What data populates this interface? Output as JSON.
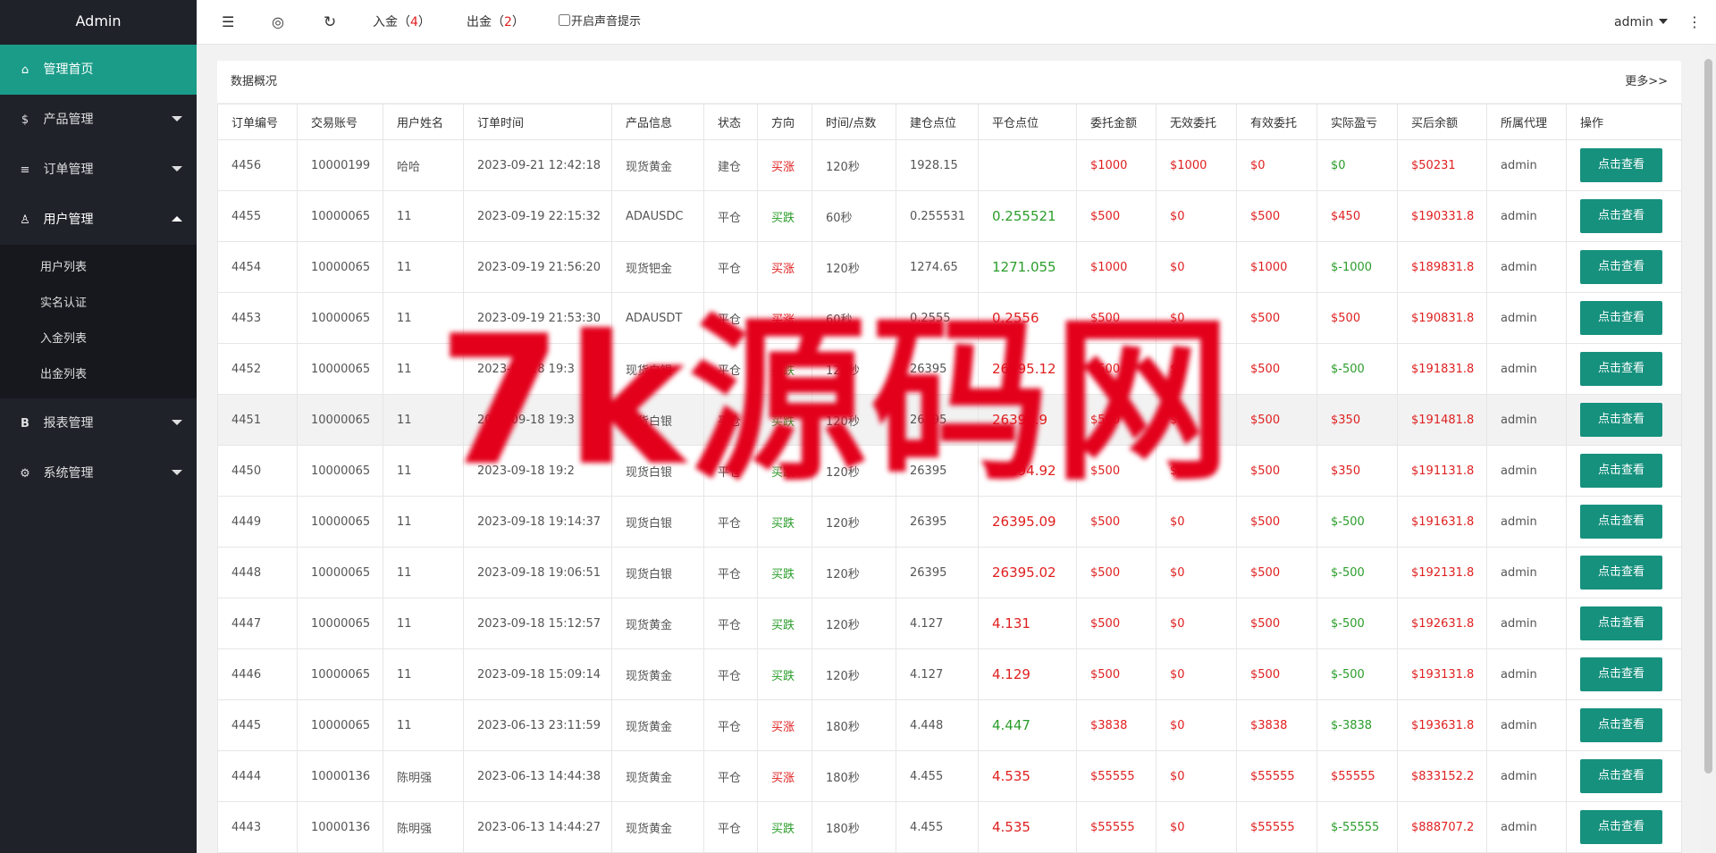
{
  "app": {
    "title": "Admin"
  },
  "sidebar": {
    "items": [
      {
        "label": "管理首页",
        "icon": "home-icon",
        "glyph": "⌂"
      },
      {
        "label": "产品管理",
        "icon": "dollar-circle-icon",
        "glyph": "$"
      },
      {
        "label": "订单管理",
        "icon": "layers-icon",
        "glyph": "≡"
      },
      {
        "label": "用户管理",
        "icon": "user-icon",
        "glyph": "♙"
      },
      {
        "label": "报表管理",
        "icon": "bold-b-icon",
        "glyph": "B"
      },
      {
        "label": "系统管理",
        "icon": "gear-icon",
        "glyph": "⚙"
      }
    ],
    "user_submenu": [
      {
        "label": "用户列表"
      },
      {
        "label": "实名认证"
      },
      {
        "label": "入金列表"
      },
      {
        "label": "出金列表"
      }
    ]
  },
  "header": {
    "menu_toggle_glyph": "☰",
    "globe_glyph": "◎",
    "refresh_glyph": "↻",
    "deposit": {
      "label": "入金（",
      "count": "4",
      "close": "）"
    },
    "withdraw": {
      "label": "出金（",
      "count": "2",
      "close": "）"
    },
    "sound_label": "开启声音提示",
    "user": "admin",
    "more_glyph": "⋮"
  },
  "card": {
    "title": "数据概况",
    "more": "更多>>"
  },
  "table": {
    "headers": [
      "订单编号",
      "交易账号",
      "用户姓名",
      "订单时间",
      "产品信息",
      "状态",
      "方向",
      "时间/点数",
      "建仓点位",
      "平仓点位",
      "委托金额",
      "无效委托",
      "有效委托",
      "实际盈亏",
      "买后余额",
      "所属代理",
      "操作"
    ],
    "button_label": "点击查看",
    "rows": [
      [
        "4456",
        "10000199",
        "哈哈",
        "2023-09-21 12:42:18",
        "现货黄金",
        "建仓",
        "买涨",
        "120秒",
        "1928.15",
        "",
        "$1000",
        "$1000",
        "$0",
        "$0",
        "$50231",
        "admin"
      ],
      [
        "4455",
        "10000065",
        "11",
        "2023-09-19 22:15:32",
        "ADAUSDC",
        "平仓",
        "买跌",
        "60秒",
        "0.255531",
        "0.255521",
        "$500",
        "$0",
        "$500",
        "$450",
        "$190331.8",
        "admin"
      ],
      [
        "4454",
        "10000065",
        "11",
        "2023-09-19 21:56:20",
        "现货钯金",
        "平仓",
        "买涨",
        "120秒",
        "1274.65",
        "1271.055",
        "$1000",
        "$0",
        "$1000",
        "$-1000",
        "$189831.8",
        "admin"
      ],
      [
        "4453",
        "10000065",
        "11",
        "2023-09-19 21:53:30",
        "ADAUSDT",
        "平仓",
        "买涨",
        "60秒",
        "0.2555",
        "0.2556",
        "$500",
        "$0",
        "$500",
        "$500",
        "$190831.8",
        "admin"
      ],
      [
        "4452",
        "10000065",
        "11",
        "2023-09-18 19:3",
        "现货白银",
        "平仓",
        "买跌",
        "120秒",
        "26395",
        "26395.12",
        "$500",
        "$0",
        "$500",
        "$-500",
        "$191831.8",
        "admin"
      ],
      [
        "4451",
        "10000065",
        "11",
        "2023-09-18 19:3",
        "现货白银",
        "平仓",
        "买跌",
        "120秒",
        "26395",
        "26394.9",
        "$500",
        "$0",
        "$500",
        "$350",
        "$191481.8",
        "admin"
      ],
      [
        "4450",
        "10000065",
        "11",
        "2023-09-18 19:2",
        "现货白银",
        "平仓",
        "买跌",
        "120秒",
        "26395",
        "26394.92",
        "$500",
        "$0",
        "$500",
        "$350",
        "$191131.8",
        "admin"
      ],
      [
        "4449",
        "10000065",
        "11",
        "2023-09-18 19:14:37",
        "现货白银",
        "平仓",
        "买跌",
        "120秒",
        "26395",
        "26395.09",
        "$500",
        "$0",
        "$500",
        "$-500",
        "$191631.8",
        "admin"
      ],
      [
        "4448",
        "10000065",
        "11",
        "2023-09-18 19:06:51",
        "现货白银",
        "平仓",
        "买跌",
        "120秒",
        "26395",
        "26395.02",
        "$500",
        "$0",
        "$500",
        "$-500",
        "$192131.8",
        "admin"
      ],
      [
        "4447",
        "10000065",
        "11",
        "2023-09-18 15:12:57",
        "现货黄金",
        "平仓",
        "买跌",
        "120秒",
        "4.127",
        "4.131",
        "$500",
        "$0",
        "$500",
        "$-500",
        "$192631.8",
        "admin"
      ],
      [
        "4446",
        "10000065",
        "11",
        "2023-09-18 15:09:14",
        "现货黄金",
        "平仓",
        "买跌",
        "120秒",
        "4.127",
        "4.129",
        "$500",
        "$0",
        "$500",
        "$-500",
        "$193131.8",
        "admin"
      ],
      [
        "4445",
        "10000065",
        "11",
        "2023-06-13 23:11:59",
        "现货黄金",
        "平仓",
        "买涨",
        "180秒",
        "4.448",
        "4.447",
        "$3838",
        "$0",
        "$3838",
        "$-3838",
        "$193631.8",
        "admin"
      ],
      [
        "4444",
        "10000136",
        "陈明强",
        "2023-06-13 14:44:38",
        "现货黄金",
        "平仓",
        "买涨",
        "180秒",
        "4.455",
        "4.535",
        "$55555",
        "$0",
        "$55555",
        "$55555",
        "$833152.2",
        "admin"
      ],
      [
        "4443",
        "10000136",
        "陈明强",
        "2023-06-13 14:44:27",
        "现货黄金",
        "平仓",
        "买跌",
        "180秒",
        "4.455",
        "4.535",
        "$55555",
        "$0",
        "$55555",
        "$-55555",
        "$888707.2",
        "admin"
      ]
    ],
    "close_colors": [
      "",
      "green",
      "green",
      "red",
      "red",
      "red",
      "red",
      "red",
      "red",
      "red",
      "red",
      "green",
      "red",
      "red"
    ]
  },
  "watermark": "7k源码网",
  "colors": {
    "accent": "#1a9c89",
    "button": "#16917e",
    "sidebar": "#20222a",
    "red": "#e02020",
    "green": "#2a9d2a"
  }
}
